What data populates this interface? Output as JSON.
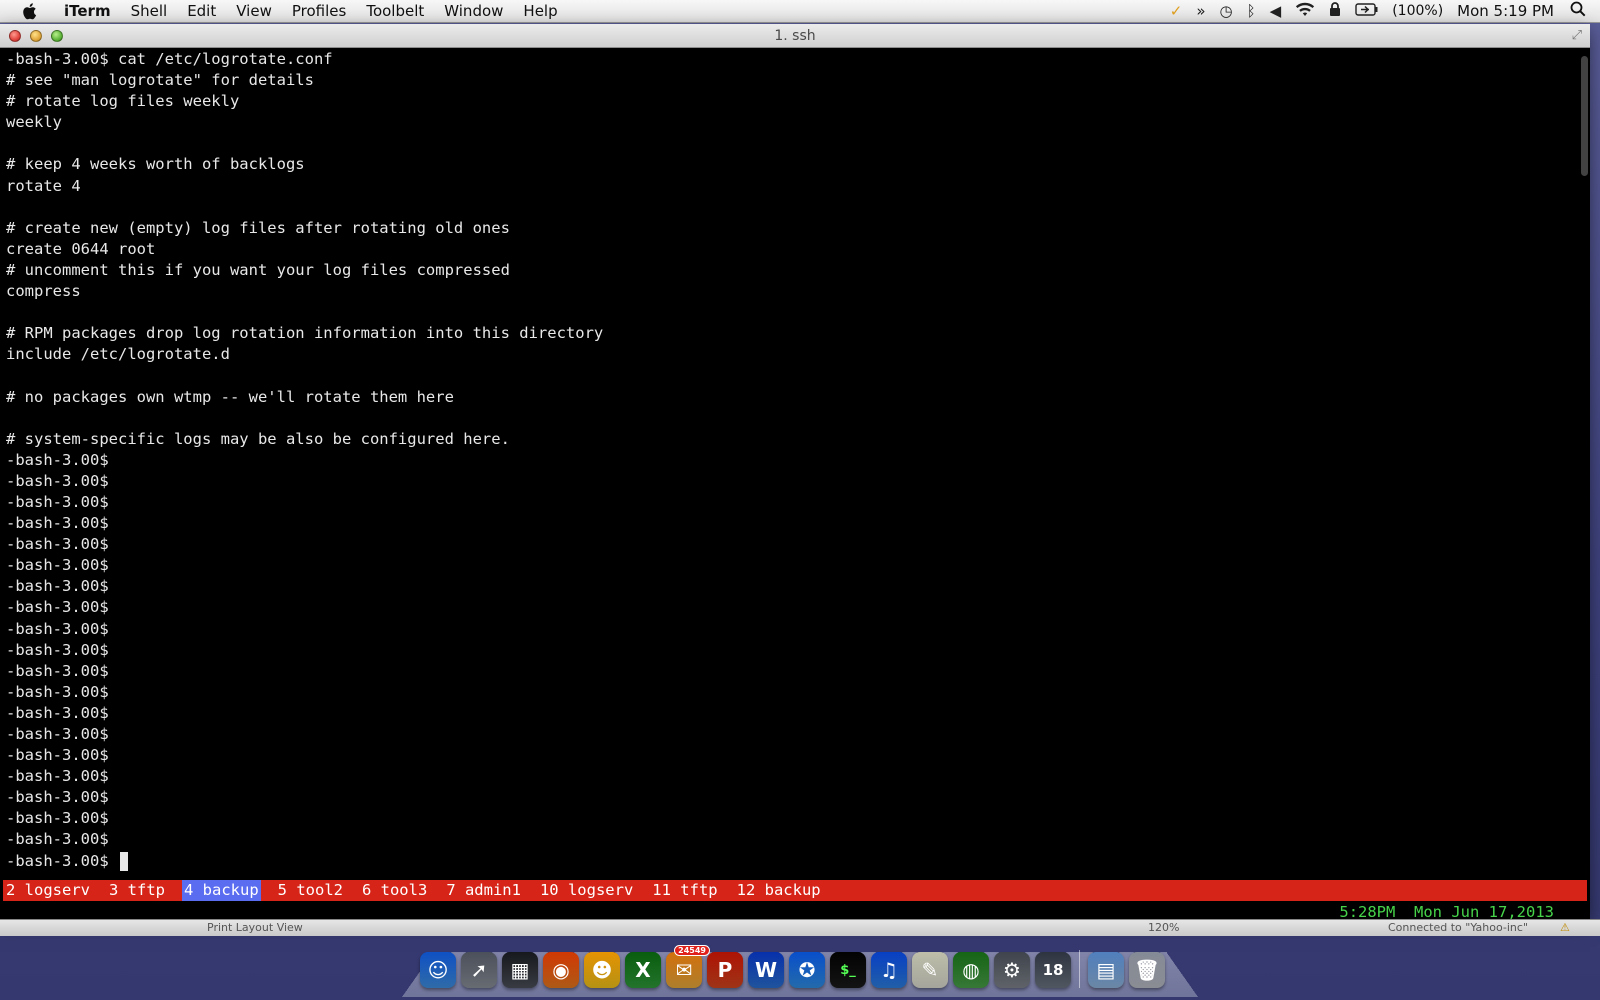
{
  "menubar": {
    "app_name": "iTerm",
    "items": [
      "Shell",
      "Edit",
      "View",
      "Profiles",
      "Toolbelt",
      "Window",
      "Help"
    ],
    "battery": "(100%)",
    "clock": "Mon 5:19 PM"
  },
  "window": {
    "title": "1. ssh"
  },
  "terminal": {
    "lines": [
      "-bash-3.00$ cat /etc/logrotate.conf",
      "# see \"man logrotate\" for details",
      "# rotate log files weekly",
      "weekly",
      "",
      "# keep 4 weeks worth of backlogs",
      "rotate 4",
      "",
      "# create new (empty) log files after rotating old ones",
      "create 0644 root",
      "# uncomment this if you want your log files compressed",
      "compress",
      "",
      "# RPM packages drop log rotation information into this directory",
      "include /etc/logrotate.d",
      "",
      "# no packages own wtmp -- we'll rotate them here",
      "",
      "# system-specific logs may be also be configured here.",
      "-bash-3.00$",
      "-bash-3.00$",
      "-bash-3.00$",
      "-bash-3.00$",
      "-bash-3.00$",
      "-bash-3.00$",
      "-bash-3.00$",
      "-bash-3.00$",
      "-bash-3.00$",
      "-bash-3.00$",
      "-bash-3.00$",
      "-bash-3.00$",
      "-bash-3.00$",
      "-bash-3.00$",
      "-bash-3.00$",
      "-bash-3.00$",
      "-bash-3.00$",
      "-bash-3.00$",
      "-bash-3.00$"
    ],
    "prompt_line": "-bash-3.00$ ",
    "screen_windows": [
      {
        "label": "2 logserv",
        "active": false
      },
      {
        "label": "3 tftp",
        "active": false
      },
      {
        "label": "4 backup",
        "active": true
      },
      {
        "label": "5 tool2",
        "active": false
      },
      {
        "label": "6 tool3",
        "active": false
      },
      {
        "label": "7 admin1",
        "active": false
      },
      {
        "label": "10 logserv",
        "active": false
      },
      {
        "label": "11 tftp",
        "active": false
      },
      {
        "label": "12 backup",
        "active": false
      }
    ],
    "screen_time": "5:28PM  Mon Jun 17,2013"
  },
  "background_app": {
    "view_label": "Print Layout View",
    "zoom": "120%",
    "connection": "Connected to \"Yahoo-inc\""
  },
  "colors": {
    "screen_bar": "#d62418",
    "active_window": "#5a6cf0",
    "time_text": "#46d34a"
  },
  "dock": {
    "apps": [
      {
        "name": "Finder",
        "icon": "finder-icon",
        "color": "#3e8fe0"
      },
      {
        "name": "Launchpad",
        "icon": "launchpad-icon",
        "color": "#8a8f98"
      },
      {
        "name": "Mission Control",
        "icon": "mission-control-icon",
        "color": "#4b4f57"
      },
      {
        "name": "Firefox",
        "icon": "firefox-icon",
        "color": "#e7781e"
      },
      {
        "name": "Yahoo Messenger",
        "icon": "messenger-icon",
        "color": "#f2c21a"
      },
      {
        "name": "Excel",
        "icon": "excel-icon",
        "color": "#2f9a3b"
      },
      {
        "name": "Outlook",
        "icon": "mail-icon",
        "color": "#e8a93a",
        "badge": "24549"
      },
      {
        "name": "PowerPoint",
        "icon": "powerpoint-icon",
        "color": "#d3461f"
      },
      {
        "name": "Word",
        "icon": "word-icon",
        "color": "#2a6fd1"
      },
      {
        "name": "Safari",
        "icon": "safari-icon",
        "color": "#2f8ee4"
      },
      {
        "name": "Terminal",
        "icon": "terminal-icon",
        "color": "#1a1a1a"
      },
      {
        "name": "iTunes",
        "icon": "itunes-icon",
        "color": "#2c7fe0"
      },
      {
        "name": "TextEdit",
        "icon": "textedit-icon",
        "color": "#dcdcd0"
      },
      {
        "name": "Network",
        "icon": "network-icon",
        "color": "#4aa04a"
      },
      {
        "name": "System Preferences",
        "icon": "gear-icon",
        "color": "#7f848c"
      },
      {
        "name": "Time Machine",
        "icon": "clock-icon",
        "color": "#6c7480"
      },
      {
        "name": "Applications",
        "icon": "folder-icon",
        "color": "#8fb4dc"
      },
      {
        "name": "Trash",
        "icon": "trash-icon",
        "color": "#b8bcc4"
      }
    ]
  }
}
